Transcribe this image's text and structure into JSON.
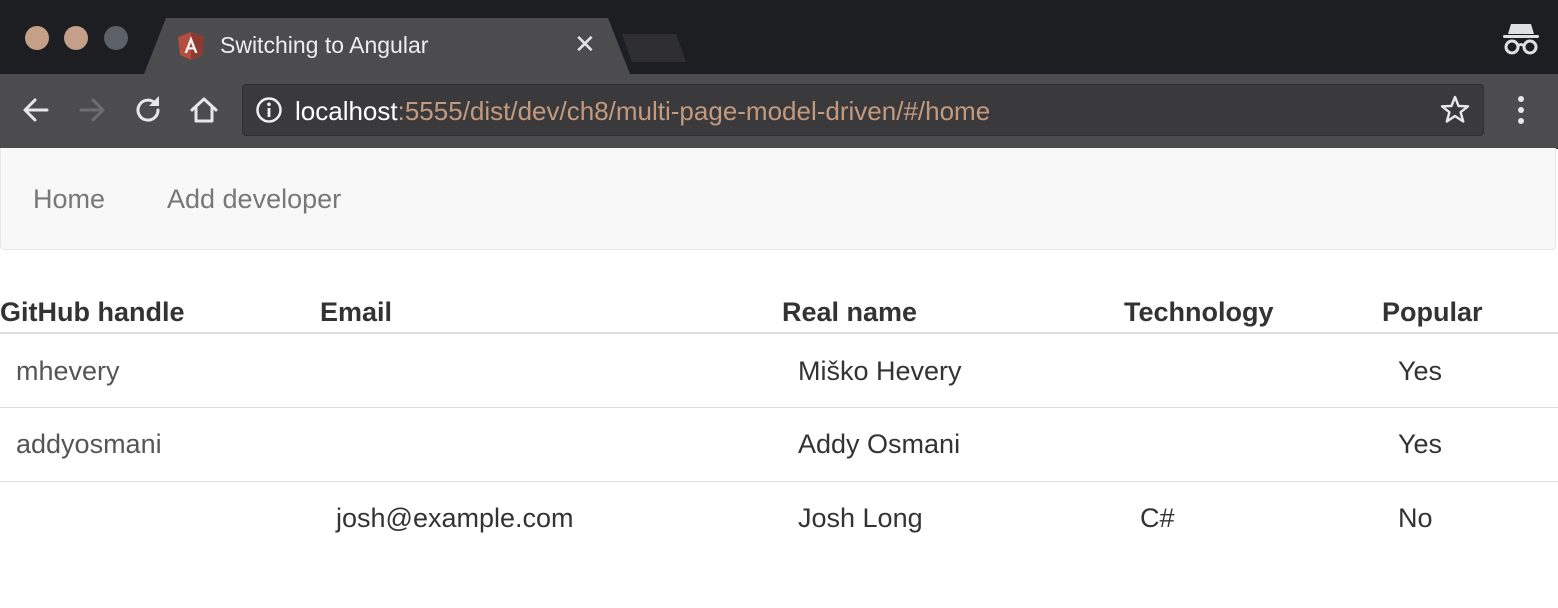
{
  "browser": {
    "tab_title": "Switching to Angular",
    "url_host": "localhost",
    "url_rest": ":5555/dist/dev/ch8/multi-page-model-driven/#/home",
    "colors": {
      "titlebar": "#1d1e21",
      "toolbar": "#4c4c4f",
      "url_path": "#c49a7e"
    }
  },
  "nav": {
    "home_label": "Home",
    "add_label": "Add developer"
  },
  "table": {
    "headers": {
      "github": "GitHub handle",
      "email": "Email",
      "realname": "Real name",
      "technology": "Technology",
      "popular": "Popular"
    },
    "rows": [
      {
        "github": "mhevery",
        "email": "",
        "realname": "Miško Hevery",
        "technology": "",
        "popular": "Yes"
      },
      {
        "github": "addyosmani",
        "email": "",
        "realname": "Addy Osmani",
        "technology": "",
        "popular": "Yes"
      },
      {
        "github": "",
        "email": "josh@example.com",
        "realname": "Josh Long",
        "technology": "C#",
        "popular": "No"
      }
    ]
  }
}
